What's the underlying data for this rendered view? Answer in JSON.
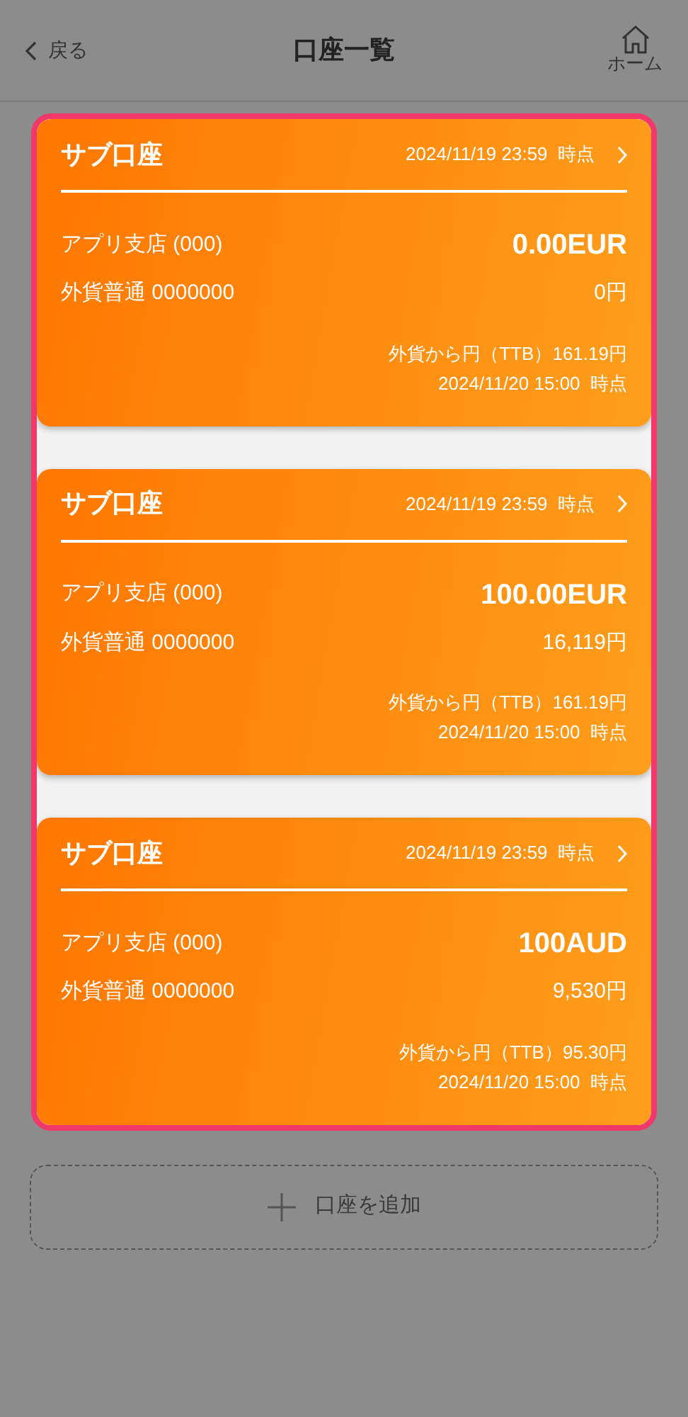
{
  "header": {
    "back_label": "戻る",
    "title": "口座一覧",
    "home_label": "ホーム"
  },
  "accounts": [
    {
      "name": "サブ口座",
      "as_of": "2024/11/19 23:59  時点",
      "branch": "アプリ支店 (000)",
      "balance": "0.00EUR",
      "account": "外貨普通 0000000",
      "yen_value": "0円",
      "rate": "外貨から円（TTB）161.19円",
      "rate_time": "2024/11/20 15:00  時点"
    },
    {
      "name": "サブ口座",
      "as_of": "2024/11/19 23:59  時点",
      "branch": "アプリ支店 (000)",
      "balance": "100.00EUR",
      "account": "外貨普通 0000000",
      "yen_value": "16,119円",
      "rate": "外貨から円（TTB）161.19円",
      "rate_time": "2024/11/20 15:00  時点"
    },
    {
      "name": "サブ口座",
      "as_of": "2024/11/19 23:59  時点",
      "branch": "アプリ支店 (000)",
      "balance": "100AUD",
      "account": "外貨普通 0000000",
      "yen_value": "9,530円",
      "rate": "外貨から円（TTB）95.30円",
      "rate_time": "2024/11/20 15:00  時点"
    }
  ],
  "add_button": {
    "label": "口座を追加"
  }
}
